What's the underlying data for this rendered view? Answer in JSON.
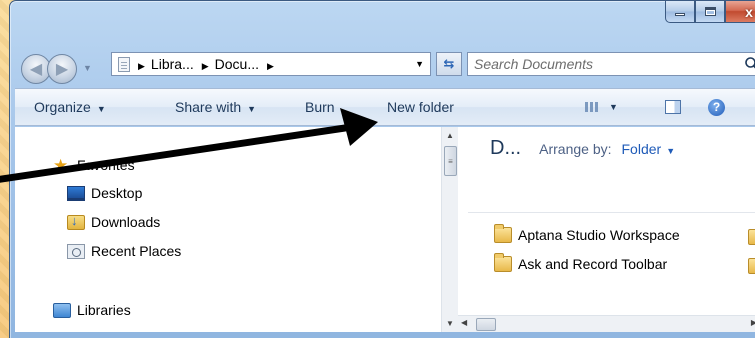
{
  "window": {
    "minimize_icon": "minimize-icon",
    "maximize_icon": "maximize-icon",
    "close_label": "x"
  },
  "nav": {
    "back_icon": "back-arrow-icon",
    "forward_icon": "forward-arrow-icon",
    "breadcrumb": [
      "Libra...",
      "Docu..."
    ],
    "refresh_icon": "refresh-icon",
    "search_placeholder": "Search Documents",
    "search_icon": "search-icon"
  },
  "command_bar": {
    "organize": "Organize",
    "share_with": "Share with",
    "burn": "Burn",
    "new_folder": "New folder"
  },
  "nav_pane": {
    "favorites": "Favorites",
    "items": [
      "Desktop",
      "Downloads",
      "Recent Places"
    ],
    "libraries": "Libraries"
  },
  "file_pane": {
    "library_title": "D...",
    "arrange_by_label": "Arrange by:",
    "arrange_by_value": "Folder",
    "folders": [
      "Aptana Studio Workspace",
      "Ask and Record Toolbar"
    ]
  },
  "colors": {
    "background": "#f5c97a",
    "frame": "#a6c6ea",
    "accent": "#1f5bb8",
    "annotation_arrow": "#000000"
  }
}
